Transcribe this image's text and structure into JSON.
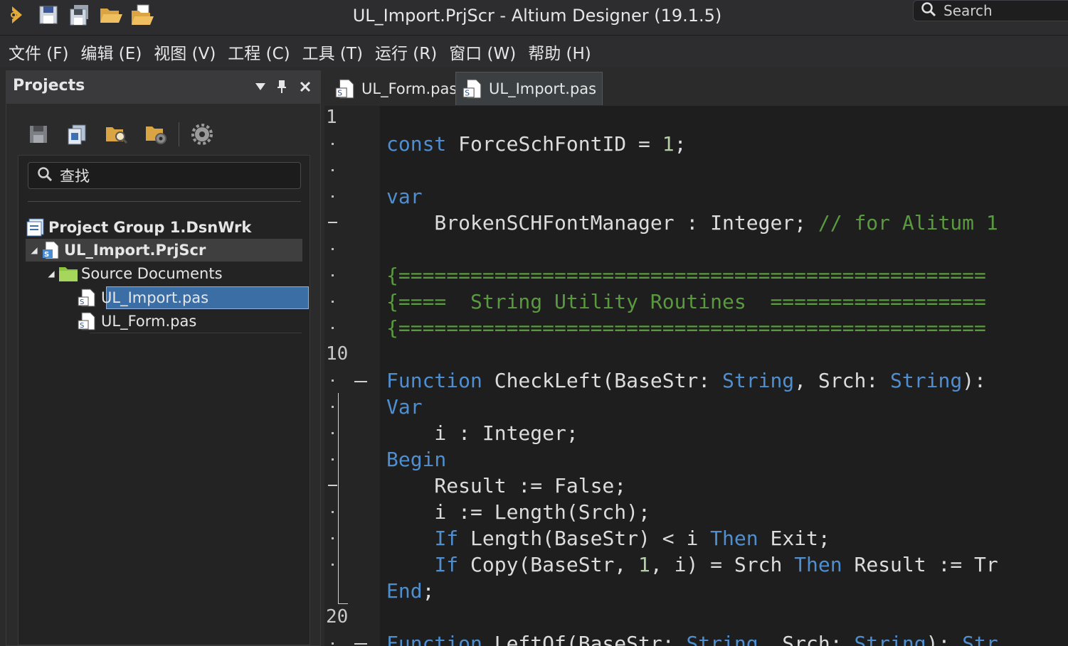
{
  "titlebar": {
    "title": "UL_Import.PrjScr - Altium Designer (19.1.5)",
    "search_label": "Search",
    "icons": [
      "altium-logo-icon",
      "save-icon",
      "save-all-icon",
      "open-icon",
      "open-project-icon"
    ]
  },
  "menu": {
    "items": [
      "文件 (F)",
      "编辑 (E)",
      "视图 (V)",
      "工程 (C)",
      "工具 (T)",
      "运行 (R)",
      "窗口 (W)",
      "帮助 (H)"
    ]
  },
  "projects_panel": {
    "title": "Projects",
    "search_placeholder": "查找",
    "tree": [
      {
        "label": "Project Group 1.DsnWrk",
        "bold": true,
        "level": 0
      },
      {
        "label": "UL_Import.PrjScr",
        "bold": true,
        "level": 1,
        "expanded": true
      },
      {
        "label": "Source Documents",
        "bold": false,
        "level": 2,
        "expanded": true
      },
      {
        "label": "UL_Import.pas",
        "bold": false,
        "level": 3,
        "selected": true
      },
      {
        "label": "UL_Form.pas",
        "bold": false,
        "level": 3
      }
    ]
  },
  "tabs": [
    {
      "label": "UL_Form.pas",
      "active": false
    },
    {
      "label": "UL_Import.pas",
      "active": true
    }
  ],
  "editor": {
    "line_numbers": {
      "line1": "1",
      "line10": "10",
      "line20": "20"
    },
    "lines": {
      "l2_kw": "const",
      "l2_name": " ForceSchFontID = ",
      "l2_num": "1",
      "l2_end": ";",
      "l4_kw": "var",
      "l5_name": "    BrokenSCHFontManager : Integer; ",
      "l5_cmt": "// for Alitum 1",
      "l7_cmt": "{=================================================",
      "l8_cmt": "{====  String Utility Routines  ==================",
      "l9_cmt": "{=================================================",
      "l11_kw1": "Function",
      "l11_a": " CheckLeft(BaseStr: ",
      "l11_kw2": "String",
      "l11_b": ", Srch: ",
      "l11_kw3": "String",
      "l11_c": "):",
      "l12_kw": "Var",
      "l13_name": "    i : Integer;",
      "l14_kw": "Begin",
      "l15_name": "    Result := False;",
      "l16_name": "    i := Length(Srch);",
      "l17_ind": "    ",
      "l17_kw1": "If",
      "l17_a": " Length(BaseStr) < i ",
      "l17_kw2": "Then",
      "l17_b": " Exit;",
      "l18_ind": "    ",
      "l18_kw1": "If",
      "l18_a": " Copy(BaseStr, ",
      "l18_num": "1",
      "l18_b": ", i) = Srch ",
      "l18_kw2": "Then",
      "l18_c": " Result := Tr",
      "l19_kw": "End",
      "l19_end": ";",
      "l21_kw1": "Function",
      "l21_a": " LeftOf(BaseStr: ",
      "l21_kw2": "String",
      "l21_b": ", Srch: ",
      "l21_kw3": "String",
      "l21_c": "): ",
      "l21_kw4": "Str"
    }
  },
  "colors": {
    "keyword": "#4f8fd0",
    "comment": "#5a9a3f",
    "number": "#b5cea8",
    "selection": "#3a6ea5"
  }
}
